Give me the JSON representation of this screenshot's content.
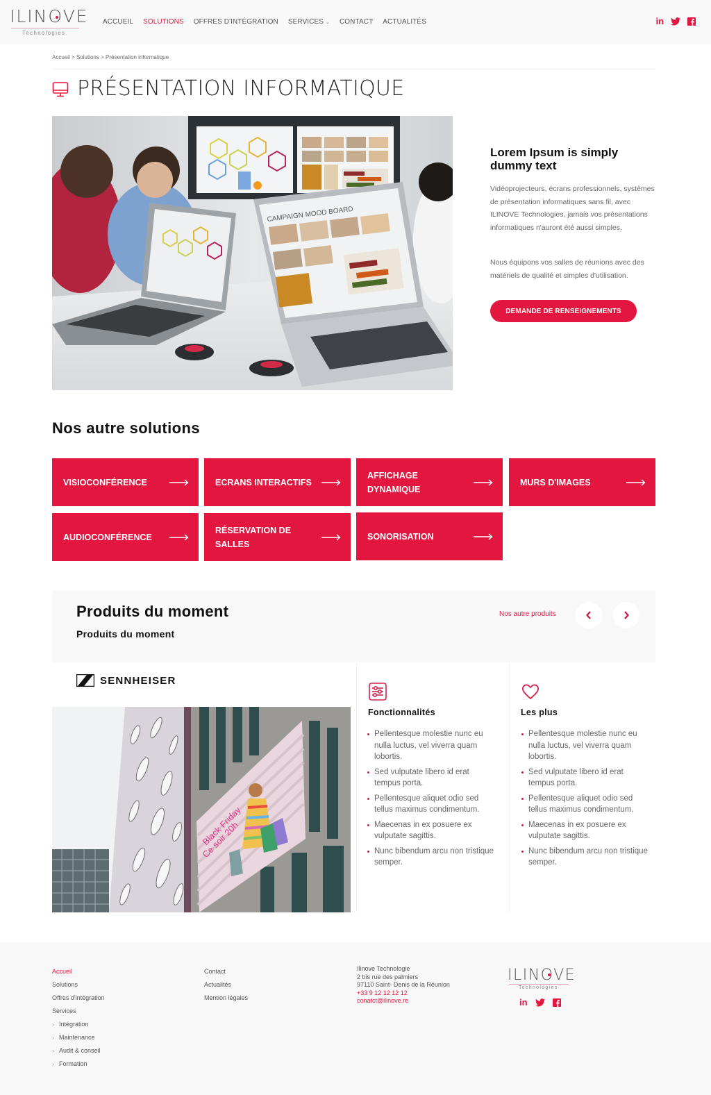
{
  "brand": {
    "name": "ILINOVE",
    "tagline": "Technologies",
    "accent_color": "#e3163f"
  },
  "nav": {
    "items": [
      {
        "label": "ACCUEIL",
        "active": false
      },
      {
        "label": "SOLUTIONS",
        "active": true
      },
      {
        "label": "OFFRES D'INTÉGRATION",
        "active": false
      },
      {
        "label": "SERVICES",
        "active": false,
        "has_dropdown": true
      },
      {
        "label": "CONTACT",
        "active": false
      },
      {
        "label": "ACTUALITÉS",
        "active": false
      }
    ],
    "social": [
      "linkedin-icon",
      "twitter-icon",
      "facebook-icon"
    ]
  },
  "breadcrumb": {
    "items": [
      "Accueil",
      "Solutions",
      "Présentation informatique"
    ],
    "separator": ">"
  },
  "page": {
    "title": "PRÉSENTATION INFORMATIQUE",
    "title_icon": "monitor-icon",
    "hero_image_alt": "Présentation informatique en salle de réunion"
  },
  "intro": {
    "title": "Lorem Ipsum is simply dummy text",
    "paragraph_1": "Vidéoprojecteurs, écrans professionnels, systèmes de présentation informatiques sans fil, avec ILINOVE Technologies, jamais vos présentations informatiques n'auront été aussi simples.",
    "paragraph_2": "Nous équipons vos salles de réunions avec des matériels de qualité et simples d'utilisation.",
    "cta_label": "DEMANDE DE RENSEIGNEMENTS"
  },
  "solutions": {
    "title": "Nos autre solutions",
    "tiles": [
      {
        "label": "VISIOCONFÉRENCE"
      },
      {
        "label": "ECRANS INTERACTIFS"
      },
      {
        "label": "AFFICHAGE DYNAMIQUE"
      },
      {
        "label": "MURS D'IMAGES"
      },
      {
        "label": "AUDIOCONFÉRENCE"
      },
      {
        "label": "RÉSERVATION DE SALLES"
      },
      {
        "label": "SONORISATION"
      }
    ]
  },
  "products": {
    "title": "Produits du moment",
    "subtitle": "Produits du moment",
    "more_link": "Nos autre produits",
    "card": {
      "brand": "SENNHEISER",
      "image_text": "Black Friday Ce soir 20h"
    },
    "features": {
      "title": "Fonctionnalités",
      "icon": "sliders-icon",
      "items": [
        "Pellentesque molestie nunc eu nulla luctus, vel viverra quam lobortis.",
        "Sed vulputate libero id erat tempus porta.",
        "Pellentesque aliquet odio sed tellus maximus condimentum.",
        "Maecenas in ex posuere ex vulputate sagittis.",
        "Nunc bibendum arcu non tristique semper."
      ]
    },
    "pluses": {
      "title": "Les plus",
      "icon": "heart-icon",
      "items": [
        "Pellentesque molestie nunc eu nulla luctus, vel viverra quam lobortis.",
        "Sed vulputate libero id erat tempus porta.",
        "Pellentesque aliquet odio sed tellus maximus condimentum.",
        "Maecenas in ex posuere ex vulputate sagittis.",
        "Nunc bibendum arcu non tristique semper."
      ]
    }
  },
  "footer": {
    "col1": [
      {
        "label": "Accueil",
        "active": true
      },
      {
        "label": "Solutions"
      },
      {
        "label": "Offres d'intégration"
      },
      {
        "label": "Services"
      },
      {
        "label": "Intégration",
        "sub": true
      },
      {
        "label": "Maintenance",
        "sub": true
      },
      {
        "label": "Audit & conseil",
        "sub": true
      },
      {
        "label": "Formation",
        "sub": true
      }
    ],
    "col2": [
      {
        "label": "Contact"
      },
      {
        "label": "Actualités"
      },
      {
        "label": "Mention légales"
      }
    ],
    "address": {
      "company": "Ilinove Technologie",
      "street": "2 bis rue des palmiers",
      "city": "97110 Saint- Denis de la Réunion",
      "phone": "+33 9 12 12 12 12",
      "email": "conatct@ilinove.re"
    }
  }
}
